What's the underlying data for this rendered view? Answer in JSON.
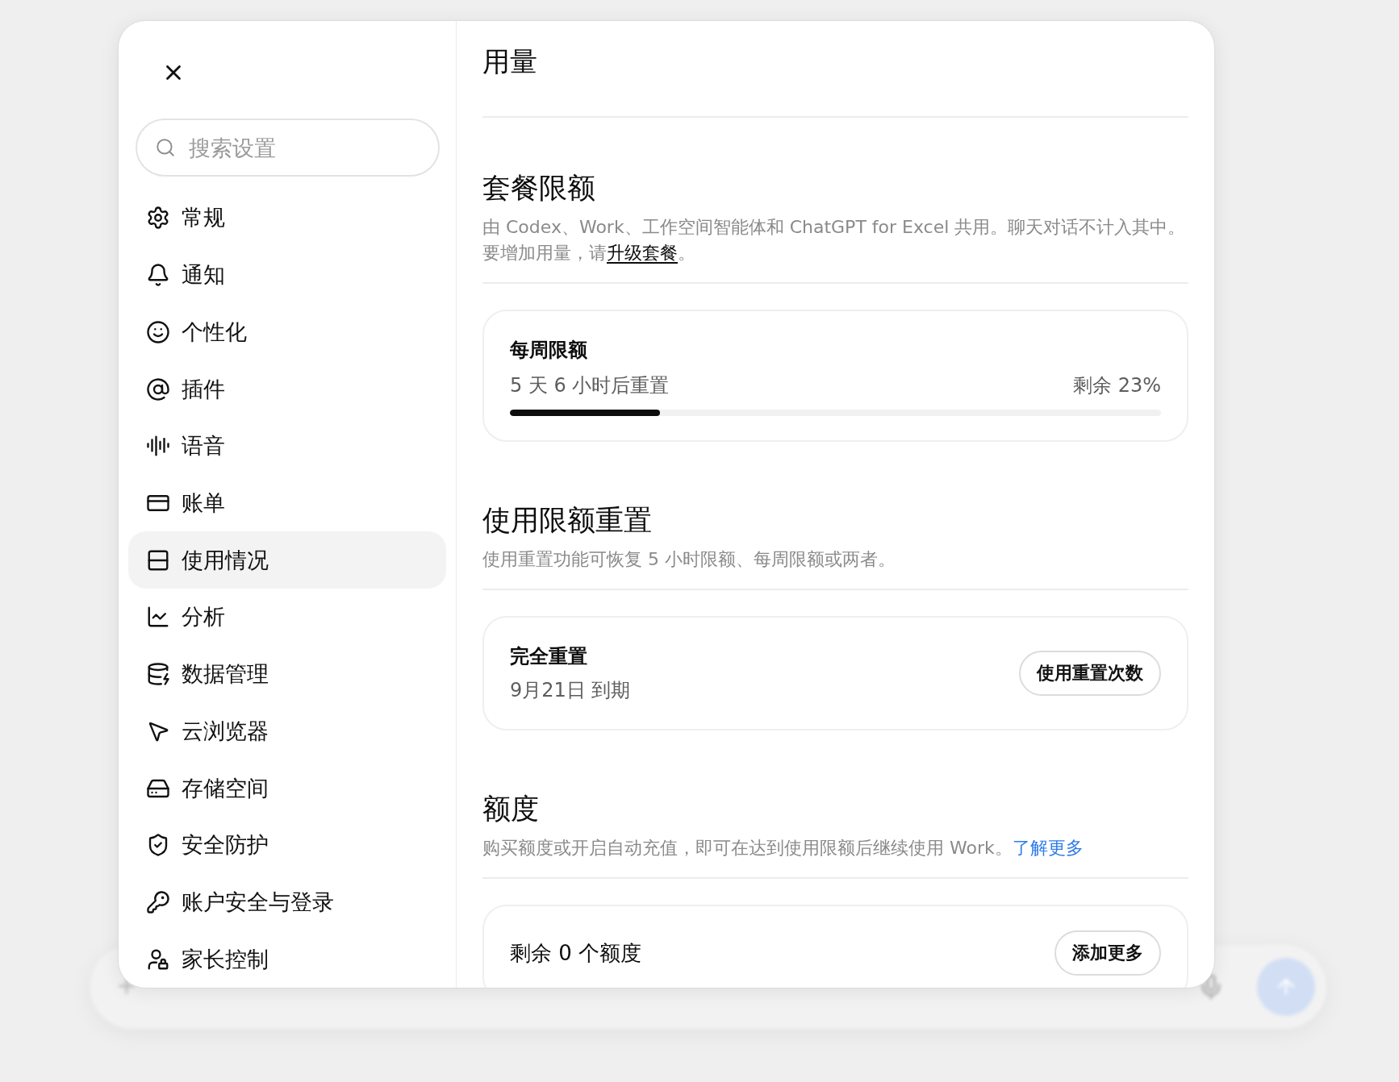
{
  "search": {
    "placeholder": "搜索设置"
  },
  "sidebar": {
    "items": [
      {
        "label": "常规",
        "selected": false
      },
      {
        "label": "通知",
        "selected": false
      },
      {
        "label": "个性化",
        "selected": false
      },
      {
        "label": "插件",
        "selected": false
      },
      {
        "label": "语音",
        "selected": false
      },
      {
        "label": "账单",
        "selected": false
      },
      {
        "label": "使用情况",
        "selected": true
      },
      {
        "label": "分析",
        "selected": false
      },
      {
        "label": "数据管理",
        "selected": false
      },
      {
        "label": "云浏览器",
        "selected": false
      },
      {
        "label": "存储空间",
        "selected": false
      },
      {
        "label": "安全防护",
        "selected": false
      },
      {
        "label": "账户安全与登录",
        "selected": false
      },
      {
        "label": "家长控制",
        "selected": false
      }
    ]
  },
  "page_title": "用量",
  "sections": [
    {
      "heading": "套餐限额",
      "description": {
        "before": "由 Codex、Work、工作空间智能体和 ChatGPT for Excel 共用。聊天对话不计入其中。要增加用量，请",
        "link": {
          "text": "升级套餐",
          "kind": "underline"
        },
        "after": "。"
      },
      "card": {
        "kind": "meter",
        "title": "每周限额",
        "subtitle": "5 天 6 小时后重置",
        "reading": "剩余 23%",
        "level": 0.23
      }
    },
    {
      "heading": "使用限额重置",
      "description": {
        "before": "使用重置功能可恢复 5 小时限额、每周限额或两者。"
      },
      "card": {
        "kind": "action",
        "title": "完全重置",
        "subtitle": "9月21日 到期",
        "button": "使用重置次数"
      }
    },
    {
      "heading": "额度",
      "description": {
        "before": "购买额度或开启自动充值，即可在达到使用限额后继续使用 Work。",
        "link": {
          "text": "了解更多",
          "kind": "accent"
        }
      },
      "card": {
        "kind": "balance",
        "title": "剩余 0 个额度",
        "button": "添加更多"
      }
    }
  ]
}
